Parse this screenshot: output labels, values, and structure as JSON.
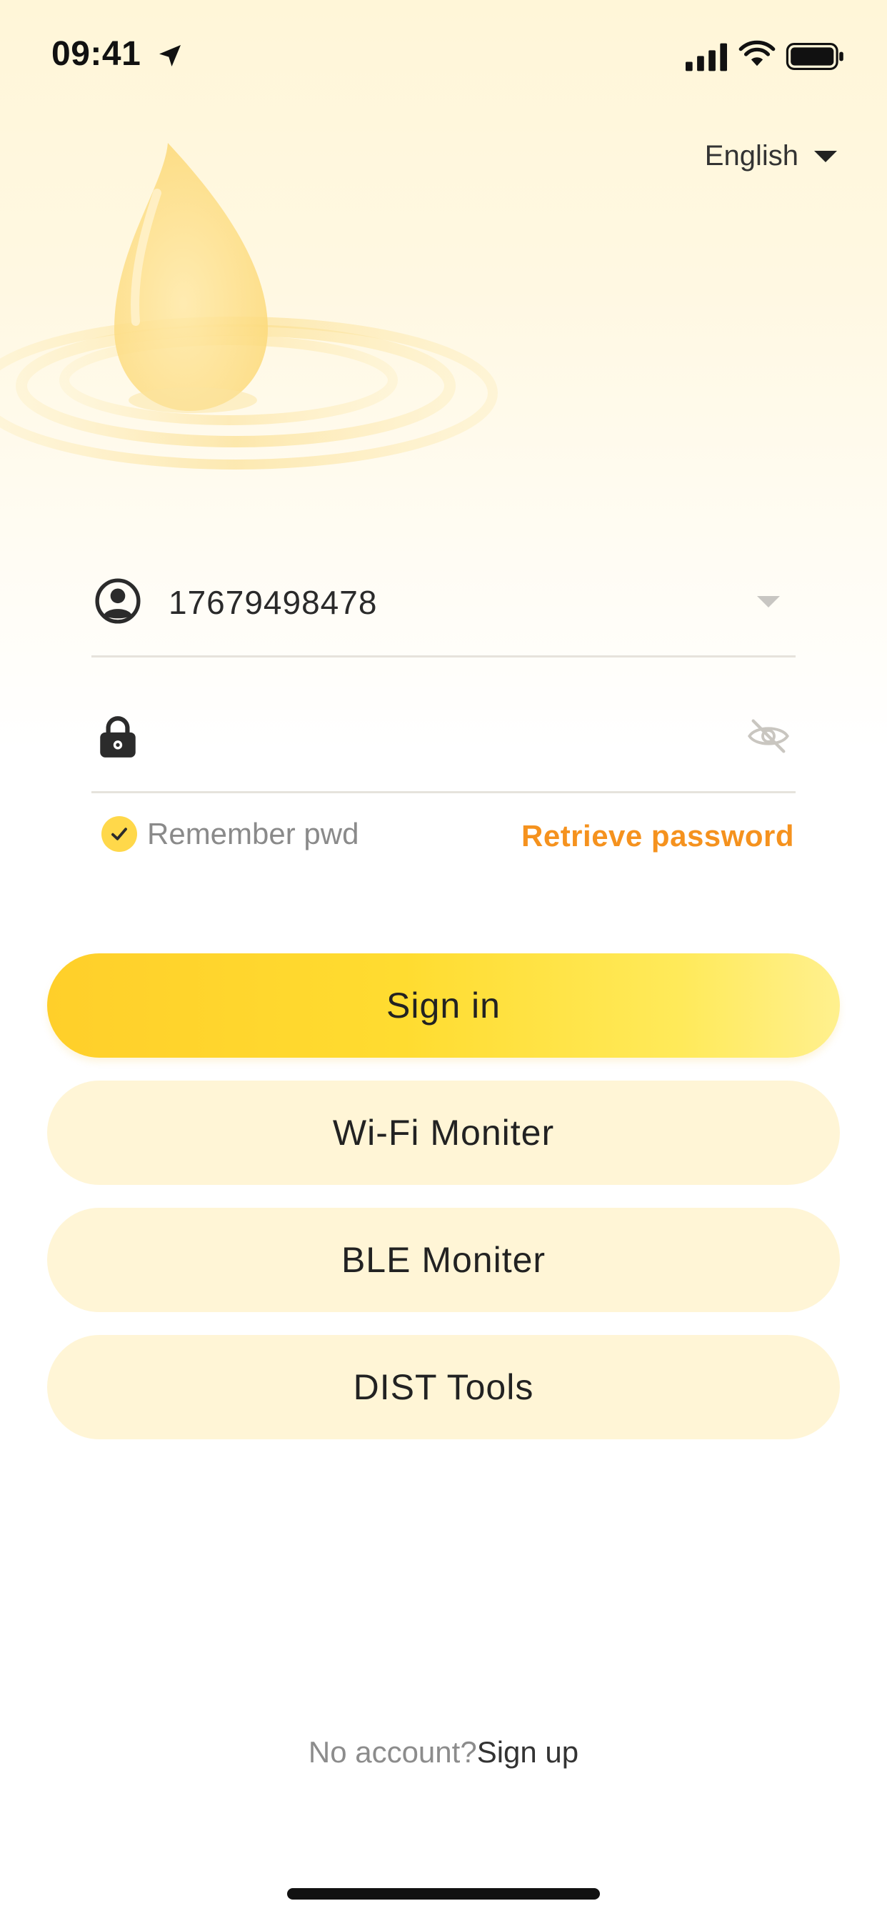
{
  "status_bar": {
    "time": "09:41"
  },
  "language": {
    "label": "English"
  },
  "login_form": {
    "account_value": "17679498478",
    "password_value": "",
    "remember_label": "Remember pwd",
    "remember_checked": true,
    "retrieve_label": "Retrieve password"
  },
  "buttons": {
    "sign_in": "Sign in",
    "wifi_monitor": "Wi-Fi Moniter",
    "ble_monitor": "BLE Moniter",
    "dist_tools": "DIST Tools"
  },
  "footer": {
    "no_account": "No account?",
    "sign_up": "Sign up"
  },
  "colors": {
    "accent_yellow": "#ffd84a",
    "link_orange": "#f5921e",
    "soft_button": "#fff5d6"
  },
  "icons": [
    "location-arrow-icon",
    "signal-icon",
    "wifi-icon",
    "battery-icon",
    "user-circle-icon",
    "lock-icon",
    "eye-slash-icon",
    "checkmark-icon",
    "chevron-down-icon"
  ]
}
